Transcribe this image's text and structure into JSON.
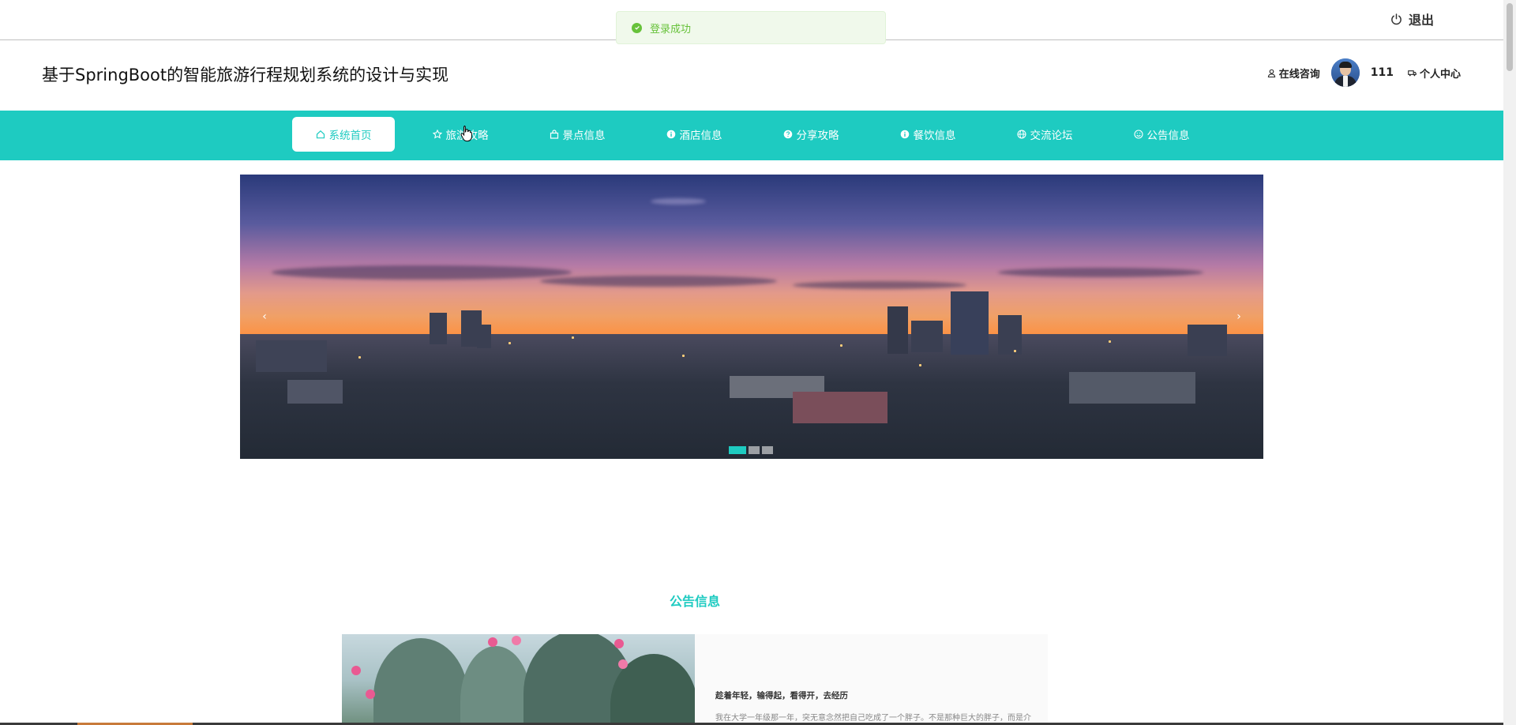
{
  "topbar": {
    "logout_label": "退出"
  },
  "toast": {
    "message": "登录成功"
  },
  "header": {
    "title": "基于SpringBoot的智能旅游行程规划系统的设计与实现",
    "online_consult": "在线咨询",
    "username": "111",
    "personal_center": "个人中心"
  },
  "nav": {
    "items": [
      {
        "label": "系统首页",
        "icon": "home-icon"
      },
      {
        "label": "旅游攻略",
        "icon": "star-icon"
      },
      {
        "label": "景点信息",
        "icon": "shop-icon"
      },
      {
        "label": "酒店信息",
        "icon": "info-icon"
      },
      {
        "label": "分享攻略",
        "icon": "question-icon"
      },
      {
        "label": "餐饮信息",
        "icon": "info-icon"
      },
      {
        "label": "交流论坛",
        "icon": "globe-icon"
      },
      {
        "label": "公告信息",
        "icon": "smile-icon"
      }
    ]
  },
  "carousel": {
    "prev": "‹",
    "next": "›",
    "slide_count": 3,
    "active_slide": 1
  },
  "section": {
    "title": "公告信息"
  },
  "notice": {
    "title": "趁着年轻，输得起，看得开，去经历",
    "body": "我在大学一年级那一年，突无意念然把自己吃成了一个胖子。不是那种巨大的胖子，而是介于"
  },
  "colors": {
    "accent": "#1ecbc1",
    "toast_green": "#67c23a"
  }
}
